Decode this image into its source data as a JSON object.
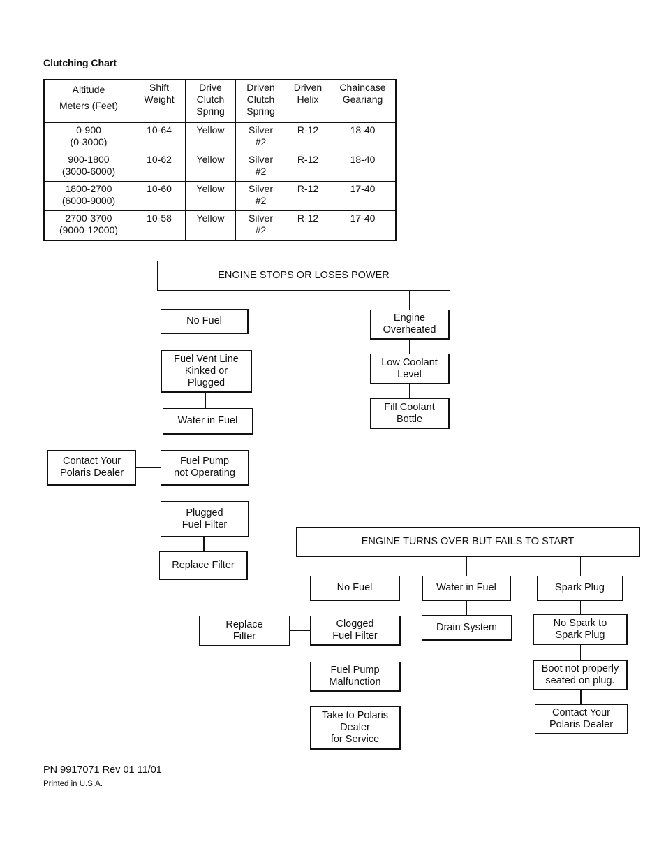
{
  "clutching_chart": {
    "title": "Clutching Chart",
    "headers": [
      "Altitude\nMeters (Feet)",
      "Shift\nWeight",
      "Drive\nClutch\nSpring",
      "Driven\nClutch\nSpring",
      "Driven\nHelix",
      "Chaincase\nGeariang"
    ],
    "rows": [
      [
        "0-900\n(0-3000)",
        "10-64",
        "Yellow",
        "Silver\n#2",
        "R-12",
        "18-40"
      ],
      [
        "900-1800\n(3000-6000)",
        "10-62",
        "Yellow",
        "Silver\n#2",
        "R-12",
        "18-40"
      ],
      [
        "1800-2700\n(6000-9000)",
        "10-60",
        "Yellow",
        "Silver\n#2",
        "R-12",
        "17-40"
      ],
      [
        "2700-3700\n(9000-12000)",
        "10-58",
        "Yellow",
        "Silver\n#2",
        "R-12",
        "17-40"
      ]
    ]
  },
  "flowchart_stops": {
    "root": "ENGINE STOPS OR LOSES POWER",
    "fuel_branch": [
      "No Fuel",
      "Fuel Vent Line\nKinked or\nPlugged",
      "Water in Fuel",
      "Fuel Pump\nnot Operating",
      "Plugged\nFuel Filter",
      "Replace Filter"
    ],
    "fuel_pump_side": "Contact Your\nPolaris Dealer",
    "overheat_branch": [
      "Engine\nOverheated",
      "Low Coolant\nLevel",
      "Fill Coolant\nBottle"
    ]
  },
  "flowchart_fails": {
    "root": "ENGINE TURNS OVER BUT FAILS TO START",
    "fuel_branch": [
      "No Fuel",
      "Clogged\nFuel Filter",
      "Fuel Pump\nMalfunction",
      "Take to Polaris\nDealer\nfor Service"
    ],
    "clogged_side": "Replace\nFilter",
    "water_branch": [
      "Water in Fuel",
      "Drain System"
    ],
    "spark_branch": [
      "Spark Plug",
      "No Spark to\nSpark Plug",
      "Boot not properly\nseated on plug.",
      "Contact Your\nPolaris Dealer"
    ]
  },
  "footer": {
    "part_number": "PN 9917071 Rev 01 11/01",
    "printed": "Printed in U.S.A."
  }
}
